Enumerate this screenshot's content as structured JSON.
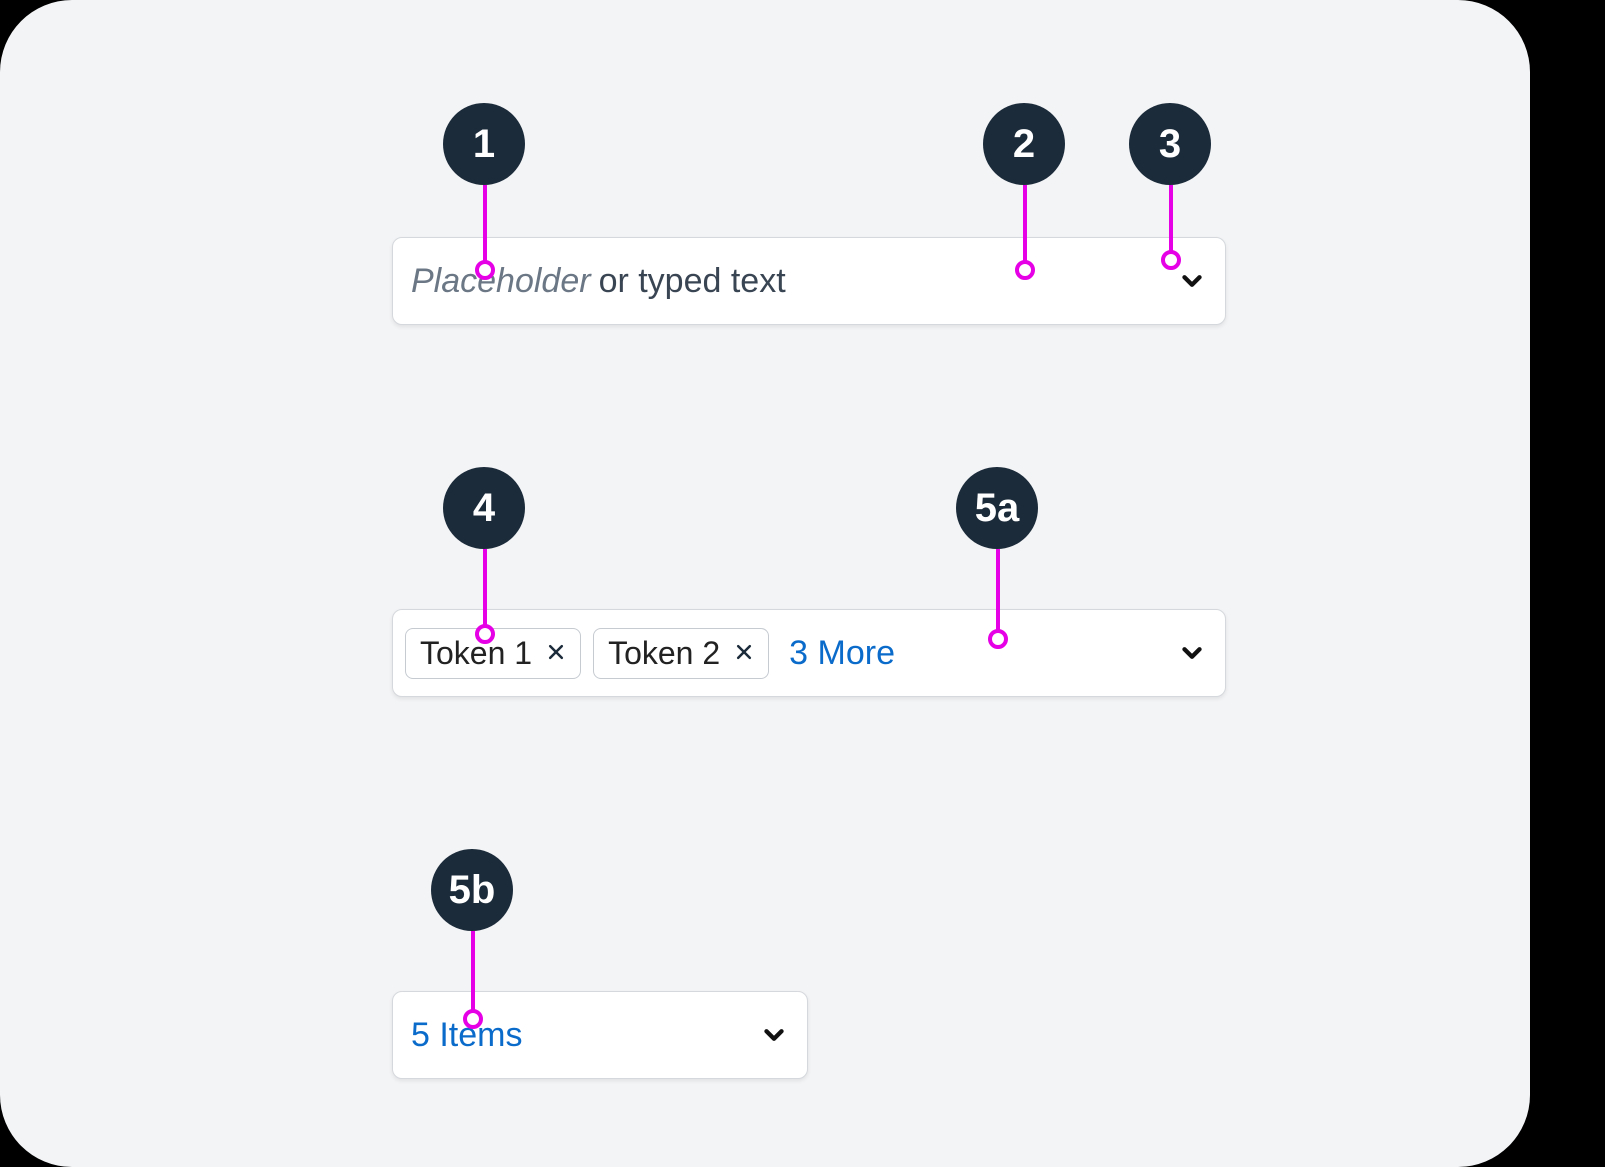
{
  "badges": {
    "b1": "1",
    "b2": "2",
    "b3": "3",
    "b4": "4",
    "b5a": "5a",
    "b5b": "5b"
  },
  "combo1": {
    "placeholder_word": "Placeholder",
    "typed_text": " or typed text"
  },
  "combo2": {
    "token1": "Token 1",
    "token2": "Token 2",
    "more": "3 More"
  },
  "combo3": {
    "items": "5 Items"
  }
}
